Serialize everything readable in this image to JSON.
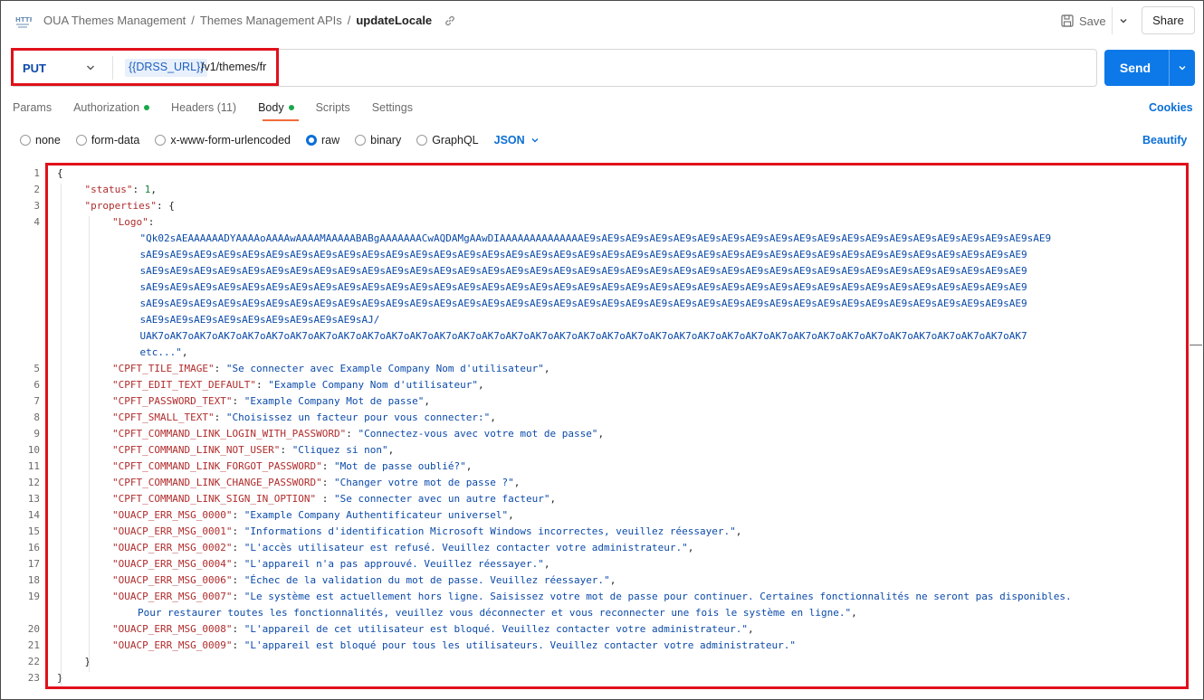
{
  "header": {
    "breadcrumbs": [
      "OUA Themes Management",
      "Themes Management APIs",
      "updateLocale"
    ],
    "save_label": "Save",
    "share_label": "Share"
  },
  "request": {
    "method": "PUT",
    "url_variable": "{{DRSS_URL}}",
    "url_path": "/v1/themes/fr",
    "send_label": "Send"
  },
  "tabs": [
    {
      "label": "Params",
      "dot": false
    },
    {
      "label": "Authorization",
      "dot": true
    },
    {
      "label": "Headers (11)",
      "dot": false
    },
    {
      "label": "Body",
      "dot": true,
      "active": true
    },
    {
      "label": "Scripts",
      "dot": false
    },
    {
      "label": "Settings",
      "dot": false
    }
  ],
  "cookies_label": "Cookies",
  "body_types": [
    {
      "label": "none",
      "selected": false
    },
    {
      "label": "form-data",
      "selected": false
    },
    {
      "label": "x-www-form-urlencoded",
      "selected": false
    },
    {
      "label": "raw",
      "selected": true
    },
    {
      "label": "binary",
      "selected": false
    },
    {
      "label": "GraphQL",
      "selected": false
    }
  ],
  "format_label": "JSON",
  "beautify_label": "Beautify",
  "editor": {
    "line_numbers": [
      "1",
      "2",
      "3",
      "4",
      "5",
      "6",
      "7",
      "8",
      "9",
      "10",
      "11",
      "12",
      "13",
      "14",
      "15",
      "16",
      "17",
      "18",
      "19",
      "20",
      "21",
      "22",
      "23"
    ],
    "lines": [
      {
        "indent": 0,
        "parts": [
          [
            "p",
            "{"
          ]
        ]
      },
      {
        "indent": 1,
        "parts": [
          [
            "k",
            "\"status\""
          ],
          [
            "p",
            ": "
          ],
          [
            "n",
            "1"
          ],
          [
            "p",
            ","
          ]
        ]
      },
      {
        "indent": 1,
        "parts": [
          [
            "k",
            "\"properties\""
          ],
          [
            "p",
            ": {"
          ]
        ]
      },
      {
        "indent": 2,
        "parts": [
          [
            "k",
            "\"Logo\""
          ],
          [
            "p",
            ":"
          ]
        ]
      },
      {
        "indent": 3,
        "parts": [
          [
            "s",
            "\"Qk02sAEAAAAAADYAAAAoAAAAwAAAAMAAAAABABgAAAAAAACwAQDAMgAAwDIAAAAAAAAAAAAAAE9sAE9sAE9sAE9sAE9sAE9sAE9sAE9sAE9sAE9sAE9sAE9sAE9sAE9sAE9sAE9sAE9sAE9sAE9sAE9"
          ]
        ]
      },
      {
        "indent": 3,
        "parts": [
          [
            "s",
            "sAE9sAE9sAE9sAE9sAE9sAE9sAE9sAE9sAE9sAE9sAE9sAE9sAE9sAE9sAE9sAE9sAE9sAE9sAE9sAE9sAE9sAE9sAE9sAE9sAE9sAE9sAE9sAE9sAE9sAE9sAE9sAE9sAE9sAE9sAE9sAE9sAE9"
          ]
        ]
      },
      {
        "indent": 3,
        "parts": [
          [
            "s",
            "sAE9sAE9sAE9sAE9sAE9sAE9sAE9sAE9sAE9sAE9sAE9sAE9sAE9sAE9sAE9sAE9sAE9sAE9sAE9sAE9sAE9sAE9sAE9sAE9sAE9sAE9sAE9sAE9sAE9sAE9sAE9sAE9sAE9sAE9sAE9sAE9sAE9"
          ]
        ]
      },
      {
        "indent": 3,
        "parts": [
          [
            "s",
            "sAE9sAE9sAE9sAE9sAE9sAE9sAE9sAE9sAE9sAE9sAE9sAE9sAE9sAE9sAE9sAE9sAE9sAE9sAE9sAE9sAE9sAE9sAE9sAE9sAE9sAE9sAE9sAE9sAE9sAE9sAE9sAE9sAE9sAE9sAE9sAE9sAE9"
          ]
        ]
      },
      {
        "indent": 3,
        "parts": [
          [
            "s",
            "sAE9sAE9sAE9sAE9sAE9sAE9sAE9sAE9sAE9sAE9sAE9sAE9sAE9sAE9sAE9sAE9sAE9sAE9sAE9sAE9sAE9sAE9sAE9sAE9sAE9sAE9sAE9sAE9sAE9sAE9sAE9sAE9sAE9sAE9sAE9sAE9sAE9"
          ]
        ]
      },
      {
        "indent": 3,
        "parts": [
          [
            "s",
            "sAE9sAE9sAE9sAE9sAE9sAE9sAE9sAE9sAE9sAJ/"
          ]
        ]
      },
      {
        "indent": 3,
        "parts": [
          [
            "s",
            "UAK7oAK7oAK7oAK7oAK7oAK7oAK7oAK7oAK7oAK7oAK7oAK7oAK7oAK7oAK7oAK7oAK7oAK7oAK7oAK7oAK7oAK7oAK7oAK7oAK7oAK7oAK7oAK7oAK7oAK7oAK7oAK7oAK7oAK7oAK7oAK7oAK7"
          ]
        ]
      },
      {
        "indent": 3,
        "parts": [
          [
            "s",
            "etc...\""
          ],
          [
            "p",
            ","
          ]
        ]
      },
      {
        "indent": 2,
        "parts": [
          [
            "k",
            "\"CPFT_TILE_IMAGE\""
          ],
          [
            "p",
            ": "
          ],
          [
            "s",
            "\"Se connecter avec Example Company Nom d'utilisateur\""
          ],
          [
            "p",
            ","
          ]
        ]
      },
      {
        "indent": 2,
        "parts": [
          [
            "k",
            "\"CPFT_EDIT_TEXT_DEFAULT\""
          ],
          [
            "p",
            ": "
          ],
          [
            "s",
            "\"Example Company Nom d'utilisateur\""
          ],
          [
            "p",
            ","
          ]
        ]
      },
      {
        "indent": 2,
        "parts": [
          [
            "k",
            "\"CPFT_PASSWORD_TEXT\""
          ],
          [
            "p",
            ": "
          ],
          [
            "s",
            "\"Example Company Mot de passe\""
          ],
          [
            "p",
            ","
          ]
        ]
      },
      {
        "indent": 2,
        "parts": [
          [
            "k",
            "\"CPFT_SMALL_TEXT\""
          ],
          [
            "p",
            ": "
          ],
          [
            "s",
            "\"Choisissez un facteur pour vous connecter:\""
          ],
          [
            "p",
            ","
          ]
        ]
      },
      {
        "indent": 2,
        "parts": [
          [
            "k",
            "\"CPFT_COMMAND_LINK_LOGIN_WITH_PASSWORD\""
          ],
          [
            "p",
            ": "
          ],
          [
            "s",
            "\"Connectez-vous avec votre mot de passe\""
          ],
          [
            "p",
            ","
          ]
        ]
      },
      {
        "indent": 2,
        "parts": [
          [
            "k",
            "\"CPFT_COMMAND_LINK_NOT_USER\""
          ],
          [
            "p",
            ": "
          ],
          [
            "s",
            "\"Cliquez si non\""
          ],
          [
            "p",
            ","
          ]
        ]
      },
      {
        "indent": 2,
        "parts": [
          [
            "k",
            "\"CPFT_COMMAND_LINK_FORGOT_PASSWORD\""
          ],
          [
            "p",
            ": "
          ],
          [
            "s",
            "\"Mot de passe oublié?\""
          ],
          [
            "p",
            ","
          ]
        ]
      },
      {
        "indent": 2,
        "parts": [
          [
            "k",
            "\"CPFT_COMMAND_LINK_CHANGE_PASSWORD\""
          ],
          [
            "p",
            ": "
          ],
          [
            "s",
            "\"Changer votre mot de passe ?\""
          ],
          [
            "p",
            ","
          ]
        ]
      },
      {
        "indent": 2,
        "parts": [
          [
            "k",
            "\"CPFT_COMMAND_LINK_SIGN_IN_OPTION\""
          ],
          [
            "p",
            " : "
          ],
          [
            "s",
            "\"Se connecter avec un autre facteur\""
          ],
          [
            "p",
            ","
          ]
        ]
      },
      {
        "indent": 2,
        "parts": [
          [
            "k",
            "\"OUACP_ERR_MSG_0000\""
          ],
          [
            "p",
            ": "
          ],
          [
            "s",
            "\"Example Company Authentificateur universel\""
          ],
          [
            "p",
            ","
          ]
        ]
      },
      {
        "indent": 2,
        "parts": [
          [
            "k",
            "\"OUACP_ERR_MSG_0001\""
          ],
          [
            "p",
            ": "
          ],
          [
            "s",
            "\"Informations d'identification Microsoft Windows incorrectes, veuillez réessayer.\""
          ],
          [
            "p",
            ","
          ]
        ]
      },
      {
        "indent": 2,
        "parts": [
          [
            "k",
            "\"OUACP_ERR_MSG_0002\""
          ],
          [
            "p",
            ": "
          ],
          [
            "s",
            "\"L'accès utilisateur est refusé. Veuillez contacter votre administrateur.\""
          ],
          [
            "p",
            ","
          ]
        ]
      },
      {
        "indent": 2,
        "parts": [
          [
            "k",
            "\"OUACP_ERR_MSG_0004\""
          ],
          [
            "p",
            ": "
          ],
          [
            "s",
            "\"L'appareil n'a pas approuvé. Veuillez réessayer.\""
          ],
          [
            "p",
            ","
          ]
        ]
      },
      {
        "indent": 2,
        "parts": [
          [
            "k",
            "\"OUACP_ERR_MSG_0006\""
          ],
          [
            "p",
            ": "
          ],
          [
            "s",
            "\"Échec de la validation du mot de passe. Veuillez réessayer.\""
          ],
          [
            "p",
            ","
          ]
        ]
      },
      {
        "indent": 2,
        "parts": [
          [
            "k",
            "\"OUACP_ERR_MSG_0007\""
          ],
          [
            "p",
            ": "
          ],
          [
            "s",
            "\"Le système est actuellement hors ligne. Saisissez votre mot de passe pour continuer. Certaines fonctionnalités ne seront pas disponibles."
          ]
        ]
      },
      {
        "indent": 2,
        "extra": 28,
        "parts": [
          [
            "s",
            "Pour restaurer toutes les fonctionnalités, veuillez vous déconnecter et vous reconnecter une fois le système en ligne.\""
          ],
          [
            "p",
            ","
          ]
        ]
      },
      {
        "indent": 2,
        "parts": [
          [
            "k",
            "\"OUACP_ERR_MSG_0008\""
          ],
          [
            "p",
            ": "
          ],
          [
            "s",
            "\"L'appareil de cet utilisateur est bloqué. Veuillez contacter votre administrateur.\""
          ],
          [
            "p",
            ","
          ]
        ]
      },
      {
        "indent": 2,
        "parts": [
          [
            "k",
            "\"OUACP_ERR_MSG_0009\""
          ],
          [
            "p",
            ": "
          ],
          [
            "s",
            "\"L'appareil est bloqué pour tous les utilisateurs. Veuillez contacter votre administrateur.\""
          ]
        ]
      },
      {
        "indent": 1,
        "parts": [
          [
            "p",
            "}"
          ]
        ]
      },
      {
        "indent": 0,
        "parts": [
          [
            "p",
            "}"
          ]
        ]
      }
    ],
    "line_number_rows": [
      0,
      1,
      2,
      3,
      12,
      13,
      14,
      15,
      16,
      17,
      18,
      19,
      20,
      21,
      22,
      23,
      24,
      25,
      26,
      28,
      29,
      30,
      31
    ]
  }
}
